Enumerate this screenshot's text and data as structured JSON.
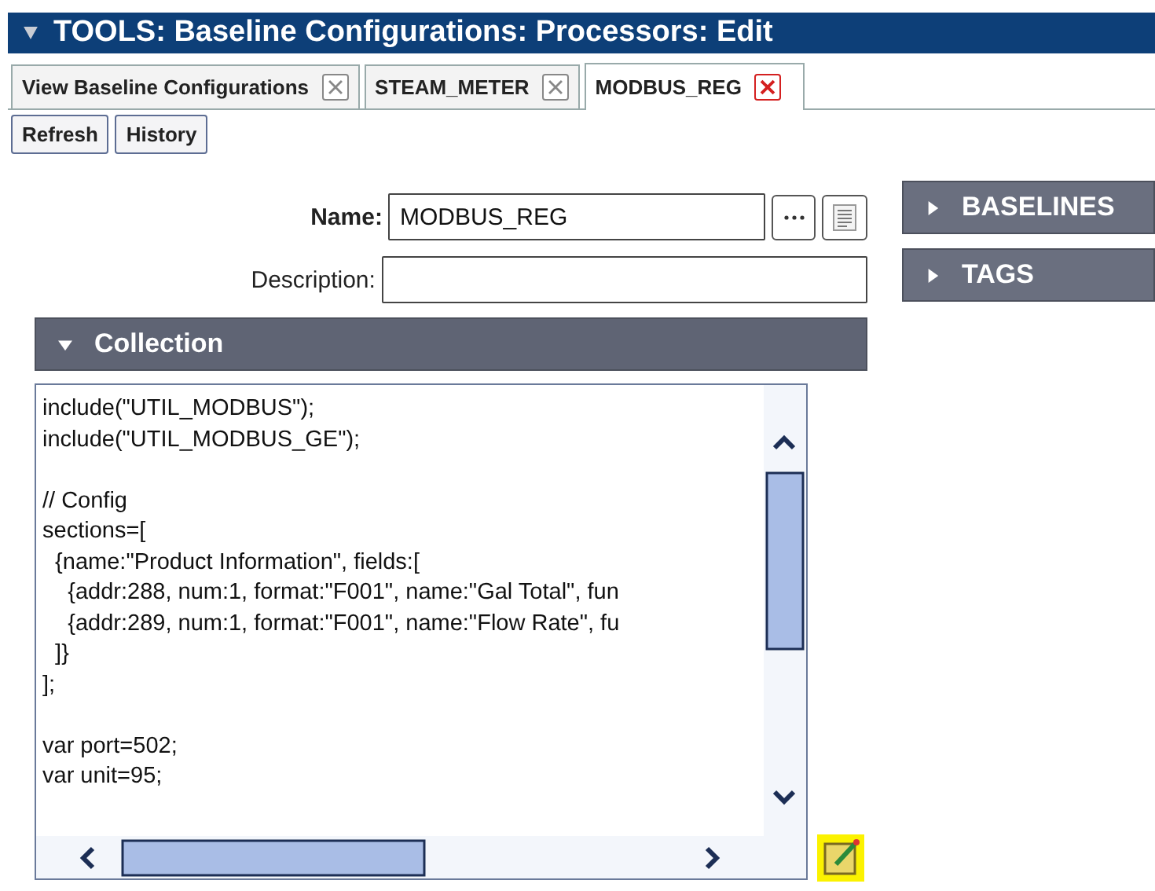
{
  "window": {
    "title": "TOOLS: Baseline Configurations: Processors: Edit",
    "expanded": true
  },
  "tabs": [
    {
      "label": "View Baseline Configurations",
      "selected": false
    },
    {
      "label": "STEAM_METER",
      "selected": false
    },
    {
      "label": "MODBUS_REG",
      "selected": true
    }
  ],
  "toolbar": {
    "buttons": [
      "Refresh",
      "History"
    ]
  },
  "form": {
    "name": {
      "label": "Name:",
      "value": "MODBUS_REG"
    },
    "description": {
      "label": "Description:"
    }
  },
  "collection": {
    "title": "Collection",
    "expanded": true,
    "code": "include(\"UTIL_MODBUS\");\ninclude(\"UTIL_MODBUS_GE\");\n\n// Config\nsections=[\n  {name:\"Product Information\", fields:[\n    {addr:288, num:1, format:\"F001\", name:\"Gal Total\", fun\n    {addr:289, num:1, format:\"F001\", name:\"Flow Rate\", fu\n  ]}\n];\n\nvar port=502;\nvar unit=95;"
  },
  "side_panels": [
    {
      "title": "BASELINES",
      "expanded": false
    },
    {
      "title": "TAGS",
      "expanded": false
    }
  ]
}
